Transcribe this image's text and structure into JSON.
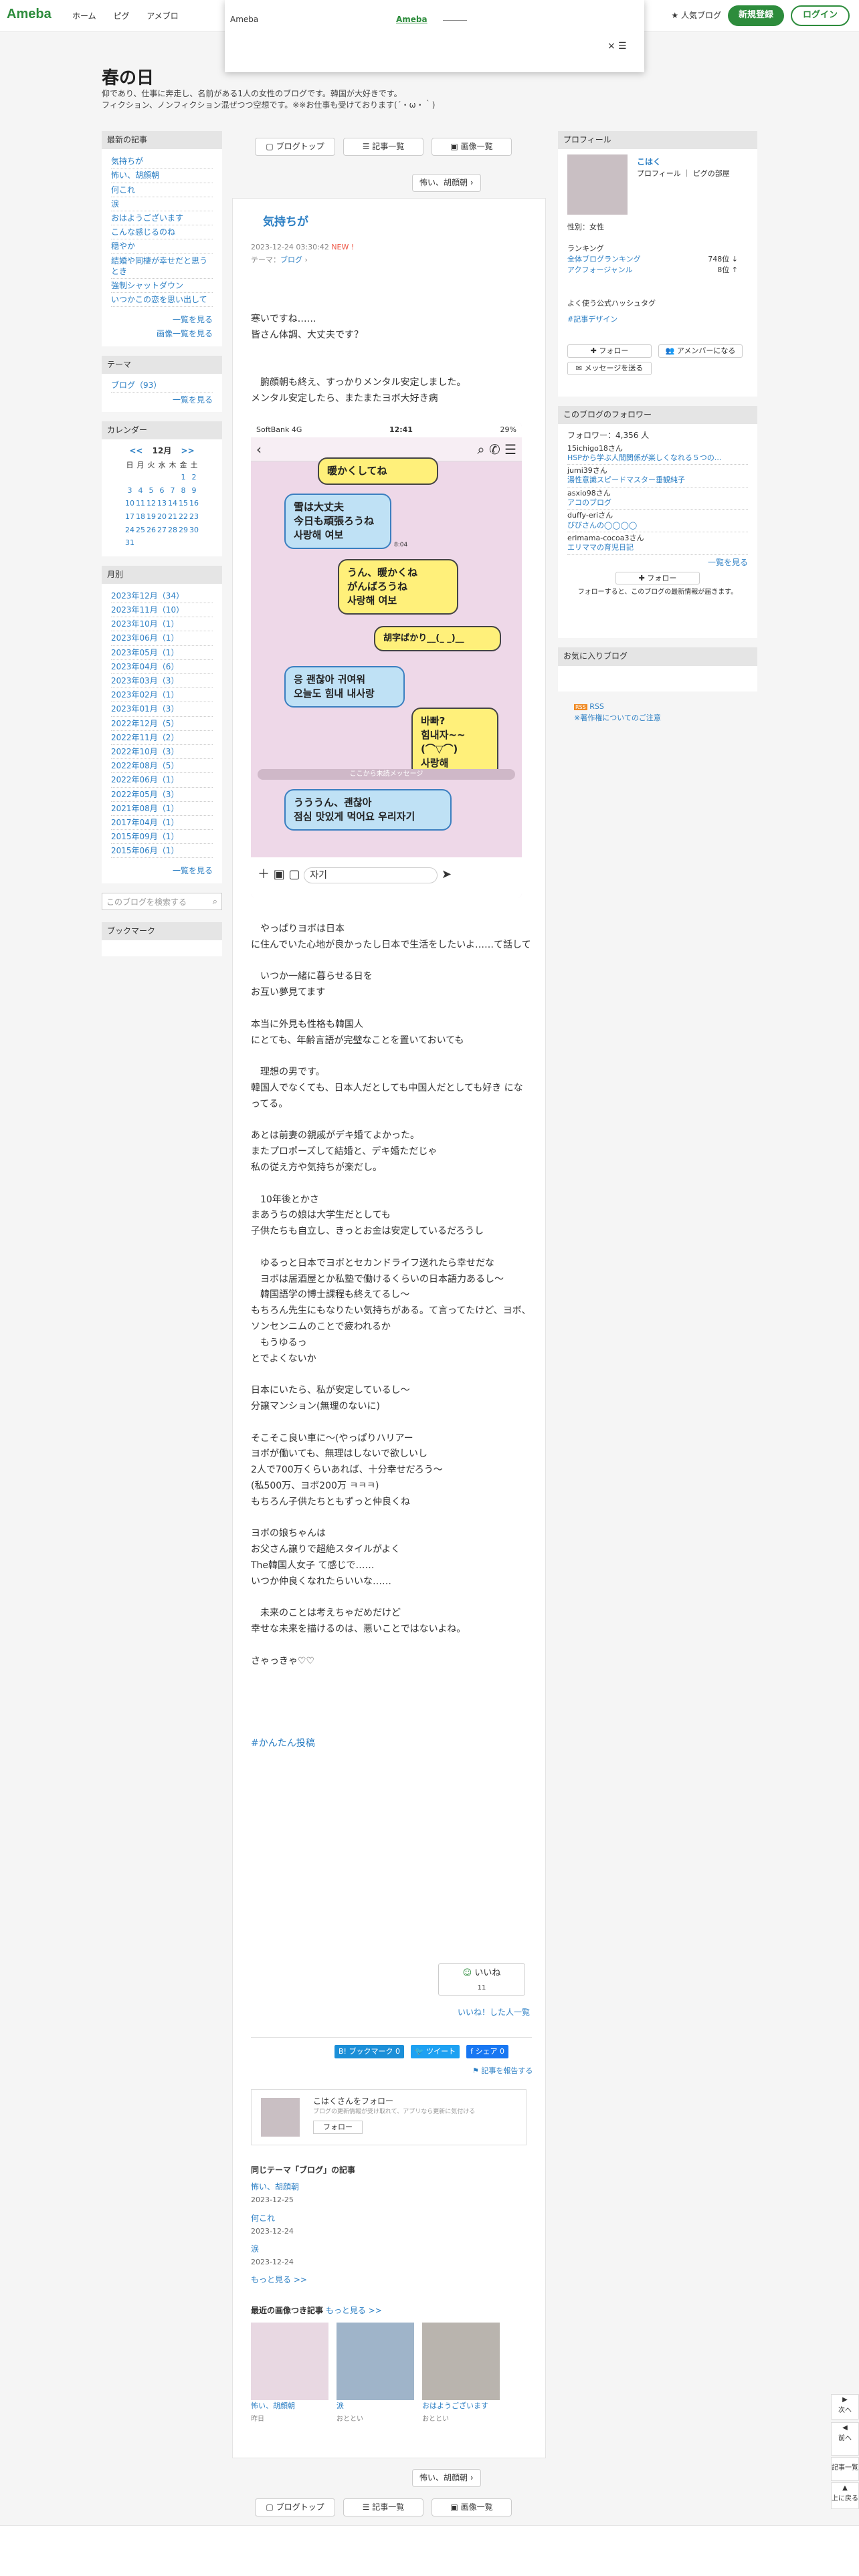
{
  "header": {
    "logo": "Ameba",
    "nav": [
      "ホーム",
      "ピグ",
      "アメブロ"
    ],
    "popular": "人気ブログ",
    "signup": "新規登録",
    "login": "ログイン"
  },
  "popup": {
    "label": "Ameba",
    "link": "Ameba",
    "close": "×"
  },
  "blog": {
    "title": "春の日",
    "desc1": "仰であり、仕事に奔走し、名前がある1人の女性のブログです。韓国が大好きです。",
    "desc2": "フィクション、ノンフィクション混ぜつつ空想です。※※お仕事も受けております(´・ω・｀)"
  },
  "topnav": {
    "top": "ブログトップ",
    "articles": "記事一覧",
    "images": "画像一覧",
    "prev": "怖い、胡顔朝"
  },
  "article": {
    "title": "気持ちが",
    "date": "2023-12-24 03:30:42",
    "new": "NEW !",
    "theme_label": "テーマ：",
    "theme": "ブログ",
    "p1": [
      "寒いですね……"
    ],
    "p2": [
      "皆さん体調、大丈夫です？"
    ],
    "p3": [
      "　腑顔朝も終え、すっかりメンタル安定しました。",
      "メンタル安定したら、またまたヨボ大好き病"
    ],
    "p4": [
      "　やっぱりヨボは日本",
      "に住んでいた心地が良かったし日本で生活をしたいよ……て話して"
    ],
    "p5": [
      "　いつか一緒に暮らせる日を",
      "お互い夢見てます"
    ],
    "p6": [
      "本当に外見も性格も韓国人",
      "にとても、年齢言語が完璧なことを置いておいても"
    ],
    "p7": [
      "　理想の男です。",
      "韓国人でなくても、日本人だとしても中国人だとしても好き になってる。"
    ],
    "p8": [
      "あとは前妻の親戚がデキ婚てよかった。",
      "またプロポーズして結婚と、デキ婚ただじゃ",
      "私の従え方や気持ちが楽だし。"
    ],
    "p9": [
      "　10年後とかさ",
      "まあうちの娘は大学生だとしても",
      "子供たちも自立し、きっとお金は安定しているだろうし"
    ],
    "p10": [
      "　ゆるっと日本でヨボとセカンドライフ送れたら幸せだな",
      "　ヨボは居酒屋とか私塾で働けるくらいの日本語力あるし〜",
      "　韓国語学の博士課程も終えてるし〜",
      "もちろん先生にもなりたい気持ちがある。て言ってたけど、ヨボ、ソンセンニムのことで疲われるか",
      "　もうゆるっ",
      "とでよくないか"
    ],
    "p11": [
      "日本にいたら、私が安定しているし〜",
      "分譲マンション(無理のないに)"
    ],
    "p12": [
      "そこそこ良い車に〜(やっぱりハリアー",
      "ヨボが働いても、無理はしないで欲しいし",
      "2人で700万くらいあれば、十分幸せだろう〜",
      "(私500万、ヨボ200万 ㅋㅋㅋ)",
      "もちろん子供たちともずっと仲良くね"
    ],
    "p13": [
      "ヨボの娘ちゃんは",
      "お父さん譲りで超絶スタイルがよく",
      "The韓国人女子 て感じで……",
      "いつか仲良くなれたらいいな……"
    ],
    "p14": [
      "　未来のことは考えちゃだめだけど",
      "幸せな未来を描けるのは、悪いことではないよね。"
    ],
    "p15": [
      "さゃっきゃ♡♡"
    ],
    "hashtag": "#かんたん投稿"
  },
  "chat": {
    "carrier": "SoftBank 4G",
    "time": "12:41",
    "battery": "29%",
    "b1": "暖かくしてね",
    "t1a": "既読",
    "t1b": "7:58",
    "b2": [
      "雪は大丈夫",
      "今日も頑張ろうね",
      "사랑해 여보"
    ],
    "t2": "8:04",
    "b3": [
      "うん、暖かくね",
      "がんばろうね",
      "사랑해 여보"
    ],
    "t3a": "既読",
    "t3b": "8:22",
    "t3c": "既読",
    "t3d": "8:23",
    "b4": "胡字ばかり__(_ _)__",
    "b5": [
      "응 괜찮아 귀여워",
      "오늘도 힘내 내사랑"
    ],
    "t5": "8:43",
    "b6": [
      "바빠?",
      "힘내자~~(⌒▽⌒)",
      "사랑해"
    ],
    "t6a": "既読",
    "t6b": "10:41",
    "divider": "ここから未読メッセージ",
    "b7": [
      "うううん、괜찮아",
      "점심 맛있게 먹어요 우리자기"
    ],
    "t7": "12:27",
    "input": "자기"
  },
  "like": {
    "label": "いいね",
    "count": "11",
    "who": "いいね！した人一覧"
  },
  "share": {
    "bookmark": "B! ブックマーク",
    "bcount": "0",
    "tweet": "ツイート",
    "fb": "シェア",
    "fcount": "0",
    "report": "記事を報告する"
  },
  "followcard": {
    "title": "こはくさんをフォロー",
    "desc": "ブログの更新情報が受け取れて、アプリなら更新に気付ける",
    "btn": "フォロー"
  },
  "same": {
    "title": "同じテーマ「ブログ」の記事",
    "items": [
      {
        "t": "怖い、胡顔朝",
        "d": "2023-12-25"
      },
      {
        "t": "何これ",
        "d": "2023-12-24"
      },
      {
        "t": "涙",
        "d": "2023-12-24"
      }
    ],
    "more": "もっと見る >>"
  },
  "recent": {
    "title": "最近の画像つき記事",
    "more": "もっと見る >>",
    "items": [
      {
        "t": "怖い、胡顔朝",
        "d": "昨日"
      },
      {
        "t": "涙",
        "d": "おととい"
      },
      {
        "t": "おはようございます",
        "d": "おととい"
      }
    ]
  },
  "left": {
    "recent_h": "最新の記事",
    "recent": [
      "気持ちが",
      "怖い、胡顔朝",
      "何これ",
      "涙",
      "おはようございます",
      "こんな感じるのね",
      "穏やか",
      "結婚や同棲が幸せだと思うとき",
      "強制シャットダウン",
      "いつかこの恋を思い出して"
    ],
    "more1": "一覧を見る",
    "more2": "画像一覧を見る",
    "theme_h": "テーマ",
    "theme": "ブログ（93）",
    "more3": "一覧を見る",
    "cal_h": "カレンダー",
    "cal_month": "12月",
    "cal_days": [
      "日",
      "月",
      "火",
      "水",
      "木",
      "金",
      "土"
    ],
    "cal": [
      [
        "",
        "",
        "",
        "",
        "",
        "1",
        "2"
      ],
      [
        "3",
        "4",
        "5",
        "6",
        "7",
        "8",
        "9"
      ],
      [
        "10",
        "11",
        "12",
        "13",
        "14",
        "15",
        "16"
      ],
      [
        "17",
        "18",
        "19",
        "20",
        "21",
        "22",
        "23"
      ],
      [
        "24",
        "25",
        "26",
        "27",
        "28",
        "29",
        "30"
      ],
      [
        "31",
        "",
        "",
        "",
        "",
        "",
        ""
      ]
    ],
    "month_h": "月別",
    "months": [
      "2023年12月（34）",
      "2023年11月（10）",
      "2023年10月（1）",
      "2023年06月（1）",
      "2023年05月（1）",
      "2023年04月（6）",
      "2023年03月（3）",
      "2023年02月（1）",
      "2023年01月（3）",
      "2022年12月（5）",
      "2022年11月（2）",
      "2022年10月（3）",
      "2022年08月（5）",
      "2022年06月（1）",
      "2022年05月（3）",
      "2021年08月（1）",
      "2017年04月（1）",
      "2015年09月（1）",
      "2015年06月（1）"
    ],
    "more4": "一覧を見る",
    "search": "このブログを検索する",
    "bookmark_h": "ブックマーク"
  },
  "right": {
    "profile_h": "プロフィール",
    "name": "こはく",
    "links": "プロフィール ｜ ピグの部屋",
    "sex": "性別：女性",
    "rank_h": "ランキング",
    "rank1": "全体ブログランキング",
    "rank1v": "748位 ↓",
    "rank2": "アクフォージャンル",
    "rank2v": "8位 ↑",
    "hashtag_h": "よく使う公式ハッシュタグ",
    "hashtag": "#記事デザイン",
    "follow": "フォロー",
    "amember": "アメンバーになる",
    "message": "メッセージを送る",
    "followers_h": "このブログのフォロワー",
    "followers": "フォロワー：4,356 人",
    "fol": [
      {
        "n": "15ichigo18さん",
        "t": "HSPから学ぶ人間関係が楽しくなれる５つの..."
      },
      {
        "n": "jumi39さん",
        "t": "湯性意識スピードマスター垂観純子"
      },
      {
        "n": "asxio98さん",
        "t": "アコのブログ"
      },
      {
        "n": "duffy-eriさん",
        "t": "びびさんの◯◯◯◯"
      },
      {
        "n": "erimama-cocoa3さん",
        "t": "エリママの育児日記"
      }
    ],
    "more": "一覧を見る",
    "follow2": "フォロー",
    "fnote": "フォローすると、このブログの最新情報が届きます。",
    "fav_h": "お気に入りブログ",
    "rss": "RSS",
    "rss2": "※著作権についてのご注意"
  },
  "fixed": {
    "next": "次へ",
    "prev": "前へ",
    "list": "記事一覧",
    "top": "上に戻る"
  }
}
